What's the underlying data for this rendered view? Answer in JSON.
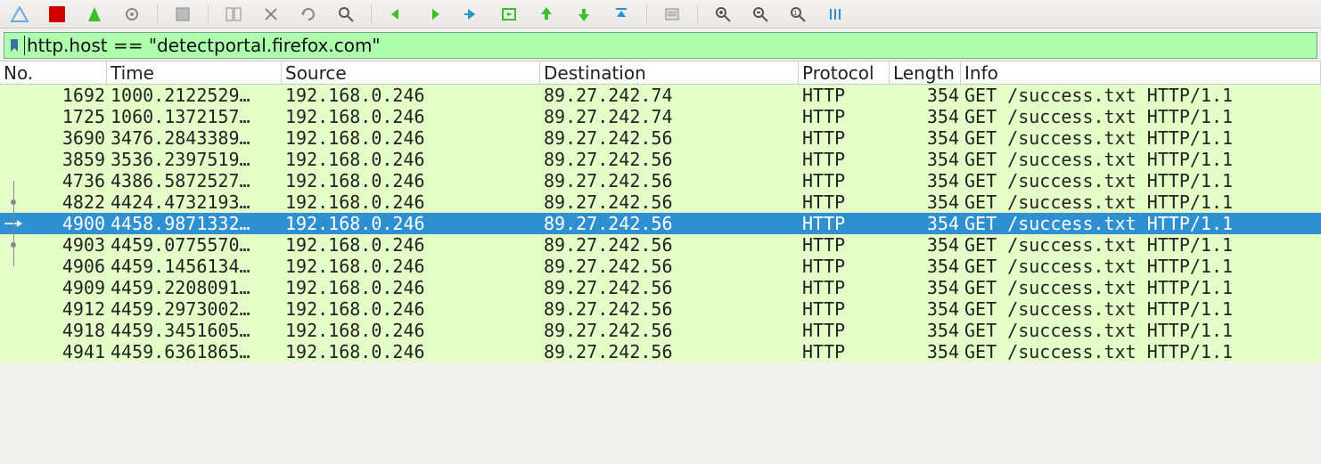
{
  "filter": {
    "value": "http.host == \"detectportal.firefox.com\""
  },
  "columns": {
    "no": "No.",
    "time": "Time",
    "source": "Source",
    "destination": "Destination",
    "protocol": "Protocol",
    "length": "Length",
    "info": "Info"
  },
  "toolbar_icons": [
    "shark-icon",
    "stop-icon",
    "restart-icon",
    "options-icon",
    "sep",
    "save-icon",
    "sep",
    "layout1-icon",
    "close-icon",
    "reload-icon",
    "find-icon",
    "sep",
    "back-icon",
    "forward-icon",
    "jump-icon",
    "goto-icon",
    "up-icon",
    "down-icon",
    "top-icon",
    "sep",
    "autoscroll-icon",
    "sep",
    "zoom-in-icon",
    "zoom-out-icon",
    "zoom-reset-icon",
    "resize-cols-icon"
  ],
  "packets": [
    {
      "no": "1692",
      "time": "1000.2122529…",
      "src": "192.168.0.246",
      "dst": "89.27.242.74",
      "proto": "HTTP",
      "len": "354",
      "info": "GET /success.txt HTTP/1.1",
      "marker": ""
    },
    {
      "no": "1725",
      "time": "1060.1372157…",
      "src": "192.168.0.246",
      "dst": "89.27.242.74",
      "proto": "HTTP",
      "len": "354",
      "info": "GET /success.txt HTTP/1.1",
      "marker": ""
    },
    {
      "no": "3690",
      "time": "3476.2843389…",
      "src": "192.168.0.246",
      "dst": "89.27.242.56",
      "proto": "HTTP",
      "len": "354",
      "info": "GET /success.txt HTTP/1.1",
      "marker": ""
    },
    {
      "no": "3859",
      "time": "3536.2397519…",
      "src": "192.168.0.246",
      "dst": "89.27.242.56",
      "proto": "HTTP",
      "len": "354",
      "info": "GET /success.txt HTTP/1.1",
      "marker": ""
    },
    {
      "no": "4736",
      "time": "4386.5872527…",
      "src": "192.168.0.246",
      "dst": "89.27.242.56",
      "proto": "HTTP",
      "len": "354",
      "info": "GET /success.txt HTTP/1.1",
      "marker": "line"
    },
    {
      "no": "4822",
      "time": "4424.4732193…",
      "src": "192.168.0.246",
      "dst": "89.27.242.56",
      "proto": "HTTP",
      "len": "354",
      "info": "GET /success.txt HTTP/1.1",
      "marker": "dot"
    },
    {
      "no": "4900",
      "time": "4458.9871332…",
      "src": "192.168.0.246",
      "dst": "89.27.242.56",
      "proto": "HTTP",
      "len": "354",
      "info": "GET /success.txt HTTP/1.1",
      "marker": "arrow",
      "selected": true
    },
    {
      "no": "4903",
      "time": "4459.0775570…",
      "src": "192.168.0.246",
      "dst": "89.27.242.56",
      "proto": "HTTP",
      "len": "354",
      "info": "GET /success.txt HTTP/1.1",
      "marker": "dot"
    },
    {
      "no": "4906",
      "time": "4459.1456134…",
      "src": "192.168.0.246",
      "dst": "89.27.242.56",
      "proto": "HTTP",
      "len": "354",
      "info": "GET /success.txt HTTP/1.1",
      "marker": "line"
    },
    {
      "no": "4909",
      "time": "4459.2208091…",
      "src": "192.168.0.246",
      "dst": "89.27.242.56",
      "proto": "HTTP",
      "len": "354",
      "info": "GET /success.txt HTTP/1.1",
      "marker": ""
    },
    {
      "no": "4912",
      "time": "4459.2973002…",
      "src": "192.168.0.246",
      "dst": "89.27.242.56",
      "proto": "HTTP",
      "len": "354",
      "info": "GET /success.txt HTTP/1.1",
      "marker": ""
    },
    {
      "no": "4918",
      "time": "4459.3451605…",
      "src": "192.168.0.246",
      "dst": "89.27.242.56",
      "proto": "HTTP",
      "len": "354",
      "info": "GET /success.txt HTTP/1.1",
      "marker": ""
    },
    {
      "no": "4941",
      "time": "4459.6361865…",
      "src": "192.168.0.246",
      "dst": "89.27.242.56",
      "proto": "HTTP",
      "len": "354",
      "info": "GET /success.txt HTTP/1.1",
      "marker": ""
    }
  ]
}
